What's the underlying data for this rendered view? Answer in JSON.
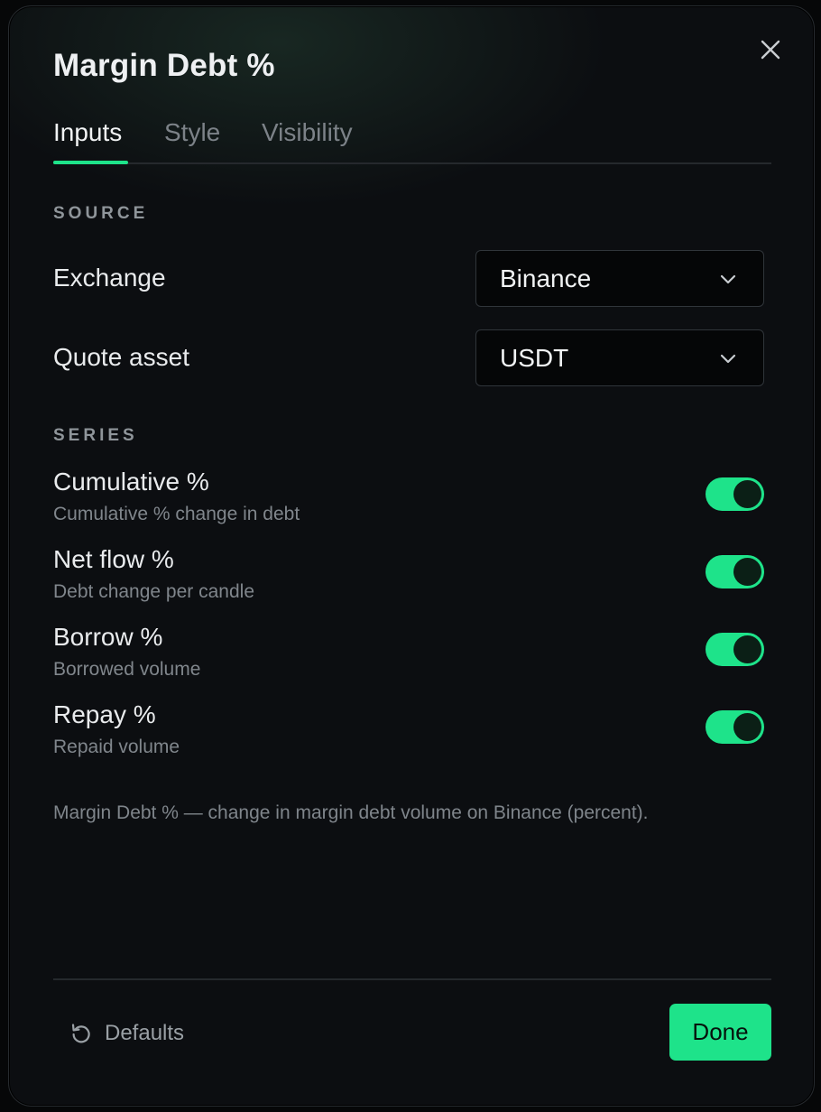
{
  "dialog": {
    "title": "Margin Debt %",
    "tabs": [
      {
        "label": "Inputs",
        "active": true
      },
      {
        "label": "Style",
        "active": false
      },
      {
        "label": "Visibility",
        "active": false
      }
    ]
  },
  "source": {
    "section_label": "SOURCE",
    "exchange": {
      "label": "Exchange",
      "value": "Binance"
    },
    "quote_asset": {
      "label": "Quote asset",
      "value": "USDT"
    }
  },
  "series": {
    "section_label": "SERIES",
    "items": [
      {
        "name": "Cumulative %",
        "description": "Cumulative % change in debt",
        "enabled": true
      },
      {
        "name": "Net flow %",
        "description": "Debt change per candle",
        "enabled": true
      },
      {
        "name": "Borrow %",
        "description": "Borrowed volume",
        "enabled": true
      },
      {
        "name": "Repay %",
        "description": "Repaid volume",
        "enabled": true
      }
    ]
  },
  "description": "Margin Debt % — change in margin debt volume on Binance (percent).",
  "footer": {
    "defaults_label": "Defaults",
    "done_label": "Done"
  },
  "icons": {
    "close": "close-icon",
    "chevron": "chevron-down-icon",
    "reset": "reset-icon"
  },
  "colors": {
    "accent": "#1ee38a",
    "background": "#0c0e11",
    "text_primary": "#e9ebed",
    "text_secondary": "#80868c"
  }
}
